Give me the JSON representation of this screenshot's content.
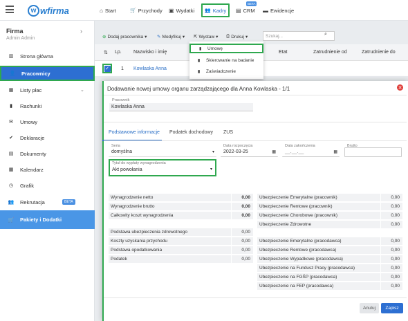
{
  "topnav": [
    {
      "id": "start",
      "icon": "home-icon",
      "glyph": "⌂",
      "label": "Start"
    },
    {
      "id": "przychody",
      "icon": "cart-icon",
      "glyph": "🛒",
      "label": "Przychody"
    },
    {
      "id": "wydatki",
      "icon": "wallet-icon",
      "glyph": "▣",
      "label": "Wydatki"
    },
    {
      "id": "kadry",
      "icon": "users-icon",
      "glyph": "👥",
      "label": "Kadry"
    },
    {
      "id": "crm",
      "icon": "address-book-icon",
      "glyph": "▤",
      "label": "CRM",
      "badge": "BETA"
    },
    {
      "id": "ewidencje",
      "icon": "folder-icon",
      "glyph": "▬",
      "label": "Ewidencje"
    }
  ],
  "logo_text": "wfirma",
  "sidebar": {
    "company": "Firma",
    "user": "Admin Admin",
    "items": [
      {
        "label": "Strona główna",
        "glyph": "▥"
      },
      {
        "label": "Pracownicy",
        "glyph": "👤"
      },
      {
        "label": "Listy płac",
        "glyph": "▦"
      },
      {
        "label": "Rachunki",
        "glyph": "▮"
      },
      {
        "label": "Umowy",
        "glyph": "✉"
      },
      {
        "label": "Deklaracje",
        "glyph": "✔"
      },
      {
        "label": "Dokumenty",
        "glyph": "▤"
      },
      {
        "label": "Kalendarz",
        "glyph": "▦"
      },
      {
        "label": "Grafik",
        "glyph": "◷"
      },
      {
        "label": "Rekrutacja",
        "glyph": "👥",
        "badge": "BETA"
      },
      {
        "label": "Pakiety i Dodatki",
        "glyph": "🛒"
      }
    ]
  },
  "toolbar": {
    "add_employee": "Dodaj pracownika",
    "modify": "Modyfikuj",
    "issue": "Wystaw",
    "print": "Drukuj",
    "search_placeholder": "Szukaj..."
  },
  "table": {
    "headers": [
      "Lp.",
      "Nazwisko i imię",
      "Etat",
      "Zatrudnienie od",
      "Zatrudnienie do"
    ],
    "rows": [
      {
        "lp": "1",
        "name": "Kowlaska Anna"
      }
    ]
  },
  "dropdown": [
    "Umowę",
    "Skierowanie na badanie",
    "Zaświadczenie"
  ],
  "modal": {
    "title": "Dodawanie nowej umowy organu zarządzającego dla Anna Kowlaska - 1/1",
    "employee_label": "Pracownik",
    "employee_value": "Kowlaska Anna",
    "tabs": [
      "Podstawowe informacje",
      "Podatek dochodowy",
      "ZUS"
    ],
    "seria_label": "Seria",
    "seria_value": "domyślna",
    "date_start_label": "Data rozpoczęcia",
    "date_start_value": "2022-03-25",
    "date_end_label": "Data zakończenia",
    "date_end_value": "__.__.__",
    "brutto_label": "Brutto",
    "tytul_label": "Tytuł do wypłaty wynagrodzenia",
    "tytul_value": "Akt powołania",
    "left_table_1": [
      {
        "label": "Wynagrodzenie netto",
        "value": "0,00"
      },
      {
        "label": "Wynagrodzenie brutto",
        "value": "0,00"
      },
      {
        "label": "Całkowity koszt wynagrodzenia",
        "value": "0,00"
      }
    ],
    "left_table_2": [
      {
        "label": "Podstawa ubezpieczenia zdrowotnego",
        "value": "0,00"
      },
      {
        "label": "Koszty uzyskania przychodu",
        "value": "0,00"
      },
      {
        "label": "Podstawa opodatkowania",
        "value": "0,00"
      },
      {
        "label": "Podatek",
        "value": "0,00"
      }
    ],
    "right_table_1": [
      {
        "label": "Ubezpieczenie Emerytalne (pracownik)",
        "value": "0,00"
      },
      {
        "label": "Ubezpieczenie Rentowe (pracownik)",
        "value": "0,00"
      },
      {
        "label": "Ubezpieczenie Chorobowe (pracownik)",
        "value": "0,00"
      },
      {
        "label": "Ubezpieczenie Zdrowotne",
        "value": "0,00"
      }
    ],
    "right_table_2": [
      {
        "label": "Ubezpieczenie Emerytalne (pracodawca)",
        "value": "0,00"
      },
      {
        "label": "Ubezpieczenie Rentowe (pracodawca)",
        "value": "0,00"
      },
      {
        "label": "Ubezpieczenie Wypadkowe (pracodawca)",
        "value": "0,00"
      },
      {
        "label": "Ubezpieczenie na Fundusz Pracy (pracodawca)",
        "value": "0,00"
      },
      {
        "label": "Ubezpieczenie na FGŚP (pracodawca)",
        "value": "0,00"
      },
      {
        "label": "Ubezpieczenie na FEP (pracodawca)",
        "value": "0,00"
      }
    ],
    "cancel": "Anuluj",
    "save": "Zapisz"
  }
}
